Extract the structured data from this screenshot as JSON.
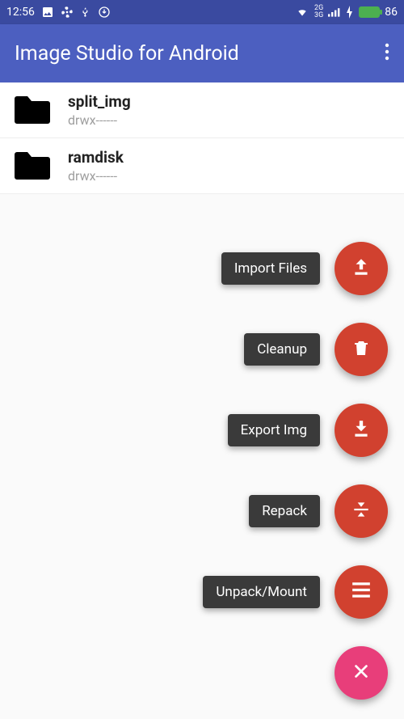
{
  "status_bar": {
    "time": "12:56",
    "battery_percent": "86",
    "net_label": "2G\n3G"
  },
  "app_bar": {
    "title": "Image Studio for Android"
  },
  "files": [
    {
      "name": "split_img",
      "perms": "drwx------"
    },
    {
      "name": "ramdisk",
      "perms": "drwx------"
    }
  ],
  "fab_actions": [
    {
      "label": "Import Files",
      "icon": "upload"
    },
    {
      "label": "Cleanup",
      "icon": "trash"
    },
    {
      "label": "Export Img",
      "icon": "download"
    },
    {
      "label": "Repack",
      "icon": "compress"
    },
    {
      "label": "Unpack/Mount",
      "icon": "menu"
    }
  ],
  "fab_close": {
    "icon": "close"
  },
  "colors": {
    "statusbar_bg": "#3a4aa0",
    "appbar_bg": "#4c5fc0",
    "fab_red": "#d1412f",
    "fab_pink": "#e83e7a",
    "label_bg": "#3a3a3a"
  },
  "watermark": ""
}
